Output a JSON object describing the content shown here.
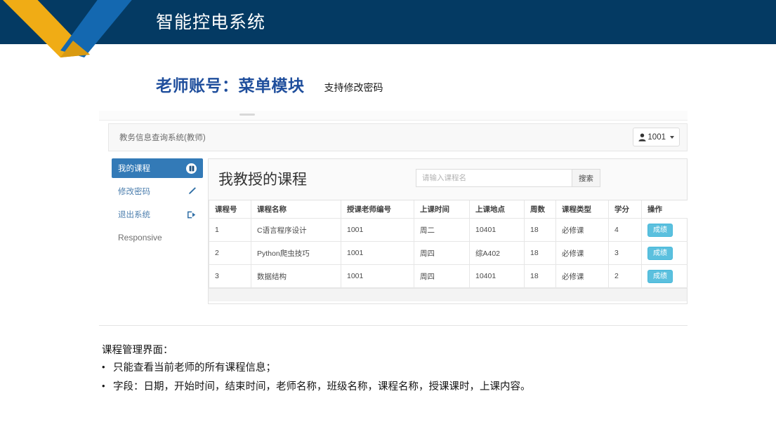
{
  "banner": {
    "title": "智能控电系统",
    "bg_color": "#043a63",
    "logo_yellow": "#f0ac15",
    "logo_blue": "#1468b0",
    "logo_name": "v-logo"
  },
  "slide": {
    "title": "老师账号：菜单模块",
    "title_color": "#1f4e9c",
    "subtitle": "支持修改密码"
  },
  "app": {
    "navbar": {
      "brand": "教务信息查询系统(教师)",
      "user_button": {
        "label": "1001",
        "icon": "user-icon",
        "caret": "chevron-down-icon"
      }
    },
    "sidebar": {
      "items": [
        {
          "label": "我的课程",
          "icon": "book-badge-icon",
          "active": true
        },
        {
          "label": "修改密码",
          "icon": "pencil-icon",
          "active": false
        },
        {
          "label": "退出系统",
          "icon": "logout-icon",
          "active": false
        }
      ],
      "footer_note": "Responsive",
      "active_color": "#337ab7"
    },
    "panel": {
      "title": "我教授的课程",
      "search": {
        "placeholder": "请输入课程名",
        "value": "",
        "button_label": "搜索"
      },
      "table": {
        "columns": [
          "课程号",
          "课程名称",
          "授课老师编号",
          "上课时间",
          "上课地点",
          "周数",
          "课程类型",
          "学分",
          "操作"
        ],
        "rows": [
          {
            "course_no": "1",
            "course_name": "C语言程序设计",
            "teacher_no": "1001",
            "class_time": "周二",
            "class_place": "10401",
            "weeks": "18",
            "course_type": "必修课",
            "credits": "4",
            "action": "成绩"
          },
          {
            "course_no": "2",
            "course_name": "Python爬虫技巧",
            "teacher_no": "1001",
            "class_time": "周四",
            "class_place": "综A402",
            "weeks": "18",
            "course_type": "必修课",
            "credits": "3",
            "action": "成绩"
          },
          {
            "course_no": "3",
            "course_name": "数据结构",
            "teacher_no": "1001",
            "class_time": "周四",
            "class_place": "10401",
            "weeks": "18",
            "course_type": "必修课",
            "credits": "2",
            "action": "成绩"
          }
        ],
        "action_button_color": "#5bc0de"
      }
    }
  },
  "notes": {
    "heading": "课程管理界面：",
    "bullet_glyph": "•",
    "items": [
      "只能查看当前老师的所有课程信息；",
      "字段：日期，开始时间，结束时间，老师名称，班级名称，课程名称，授课课时，上课内容。"
    ]
  }
}
